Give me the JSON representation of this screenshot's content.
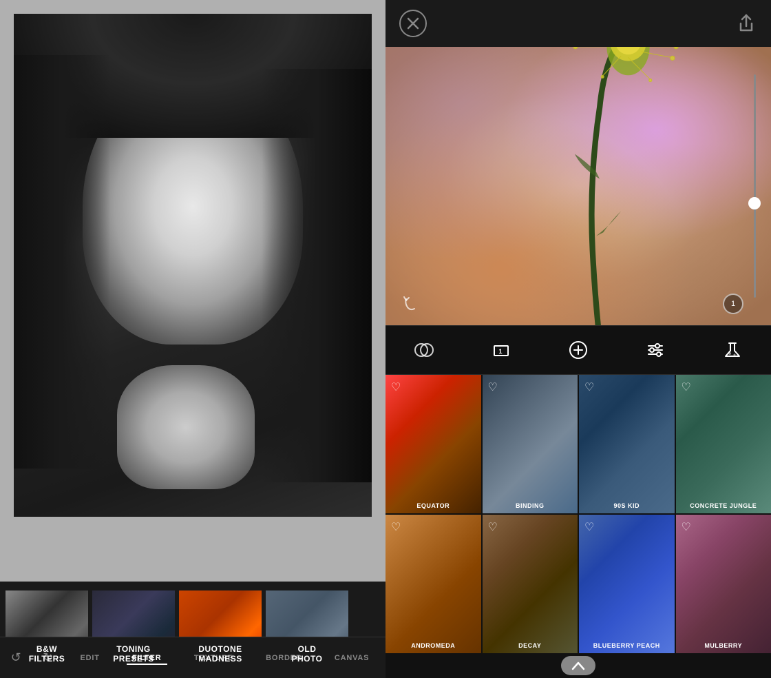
{
  "left_panel": {
    "filter_presets": [
      {
        "id": "bw-filters",
        "label": "B&W\nFILTERS",
        "label_line1": "B&W",
        "label_line2": "FILTERS",
        "style": "preset-bw"
      },
      {
        "id": "toning-presets",
        "label": "TONING\nPRESETS",
        "label_line1": "TONING",
        "label_line2": "PRESETS",
        "style": "preset-toning"
      },
      {
        "id": "duotone-madness",
        "label": "DUOTONE\nMADNESS",
        "label_line1": "DUOTONE",
        "label_line2": "MADNESS",
        "style": "preset-duotone"
      },
      {
        "id": "old-photo",
        "label": "OLD\nPHOTO",
        "label_line1": "OLD",
        "label_line2": "PHOTO",
        "style": "preset-oldphoto"
      }
    ],
    "nav_items": [
      {
        "id": "undo",
        "type": "icon",
        "icon": "↺"
      },
      {
        "id": "redo",
        "type": "icon",
        "icon": "↻"
      },
      {
        "id": "edit",
        "label": "EDIT",
        "active": false
      },
      {
        "id": "filter",
        "label": "FILTER",
        "active": true
      },
      {
        "id": "texture",
        "label": "TEXTURE",
        "active": false
      },
      {
        "id": "border",
        "label": "BORDER",
        "active": false
      },
      {
        "id": "canvas",
        "label": "CANVAS",
        "active": false
      }
    ]
  },
  "right_panel": {
    "top_bar": {
      "close_icon": "✕",
      "share_icon": "↑"
    },
    "slider": {
      "value": 55,
      "min": 0,
      "max": 100
    },
    "badge_value": "1",
    "tools": [
      {
        "id": "blend",
        "icon": "⊙"
      },
      {
        "id": "layers",
        "icon": "▭"
      },
      {
        "id": "add",
        "icon": "⊕"
      },
      {
        "id": "adjust",
        "icon": "⊞"
      },
      {
        "id": "lab",
        "icon": "⚗"
      }
    ],
    "filters": [
      {
        "id": "equator",
        "name": "EQUATOR",
        "style": "filter-equator",
        "liked": true
      },
      {
        "id": "binding",
        "name": "BINDING",
        "style": "filter-binding",
        "liked": true
      },
      {
        "id": "90s-kid",
        "name": "90S KID",
        "style": "filter-90skid",
        "liked": true
      },
      {
        "id": "concrete-jungle",
        "name": "CONCRETE JUNGLE",
        "style": "filter-concrete",
        "liked": true
      },
      {
        "id": "andromeda",
        "name": "ANDROMEDA",
        "style": "filter-andromeda",
        "liked": true
      },
      {
        "id": "decay",
        "name": "DECAY",
        "style": "filter-decay",
        "liked": true
      },
      {
        "id": "blueberry-peach",
        "name": "BLUEBERRY PEACH",
        "style": "filter-blueberry",
        "liked": true
      },
      {
        "id": "mulberry",
        "name": "MULBERRY",
        "style": "filter-mulberry",
        "liked": true
      }
    ]
  }
}
